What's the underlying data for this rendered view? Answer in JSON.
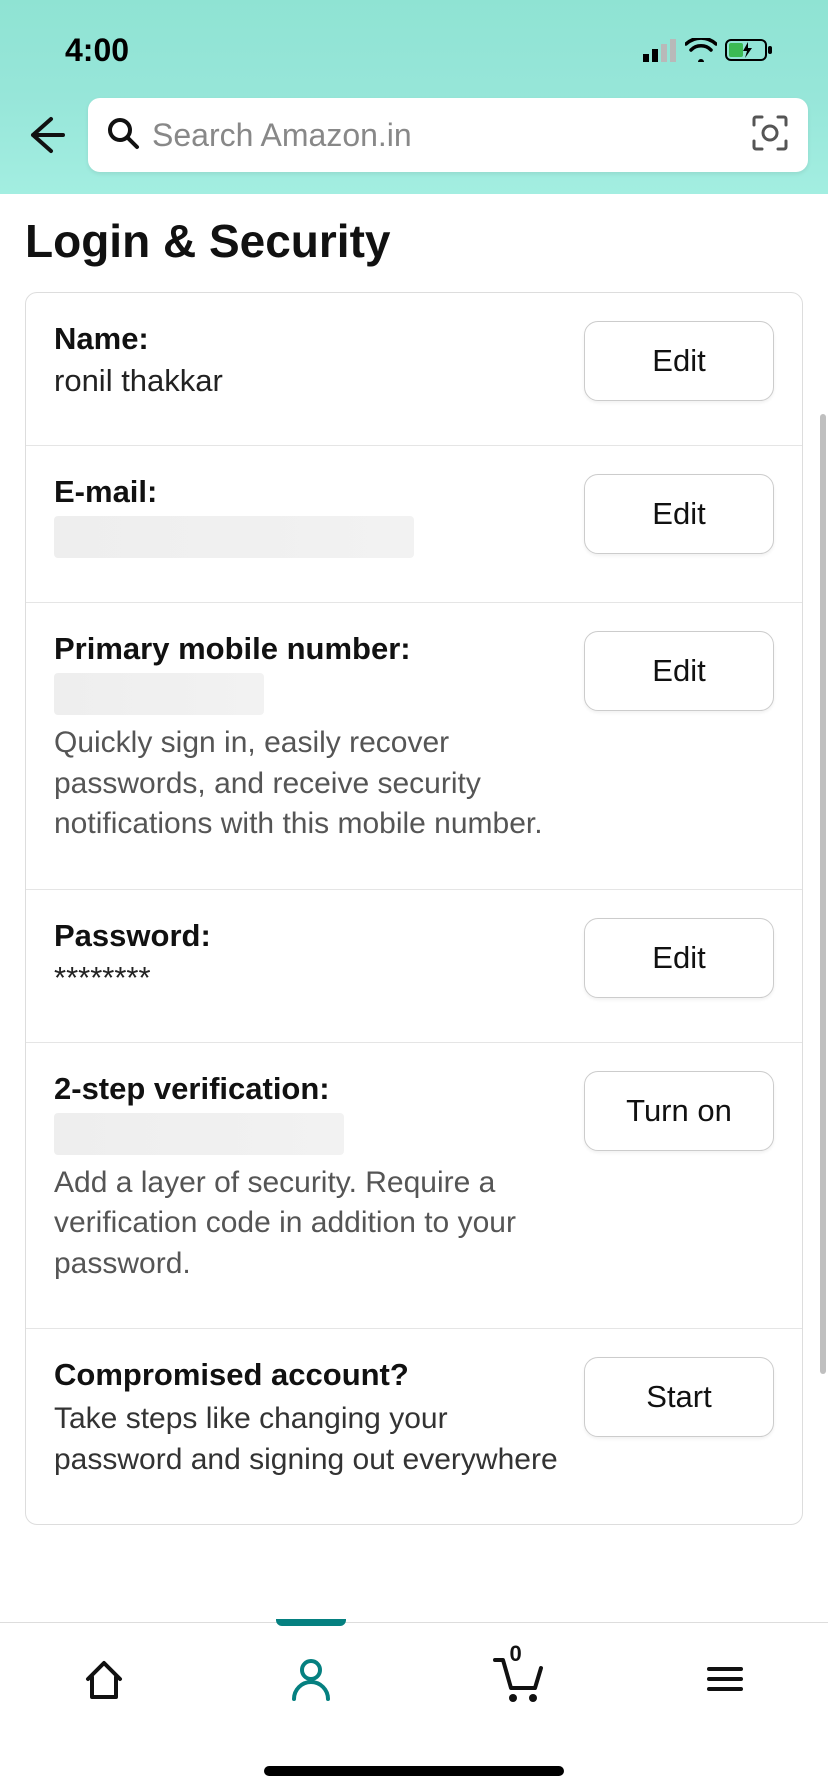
{
  "status": {
    "time": "4:00"
  },
  "search": {
    "placeholder": "Search Amazon.in"
  },
  "page": {
    "title": "Login & Security"
  },
  "settings": {
    "name": {
      "label": "Name:",
      "value": "ronil thakkar",
      "action": "Edit"
    },
    "email": {
      "label": "E-mail:",
      "action": "Edit"
    },
    "phone": {
      "label": "Primary mobile number:",
      "desc": "Quickly sign in, easily recover passwords, and receive security notifications with this mobile number.",
      "action": "Edit"
    },
    "password": {
      "label": "Password:",
      "value": "********",
      "action": "Edit"
    },
    "twostep": {
      "label": "2-step verification:",
      "desc": "Add a layer of security. Require a verification code in addition to your password.",
      "action": "Turn on"
    },
    "compromised": {
      "label": "Compromised account?",
      "desc": "Take steps like changing your password and signing out everywhere",
      "action": "Start"
    }
  },
  "nav": {
    "cart_count": "0"
  }
}
